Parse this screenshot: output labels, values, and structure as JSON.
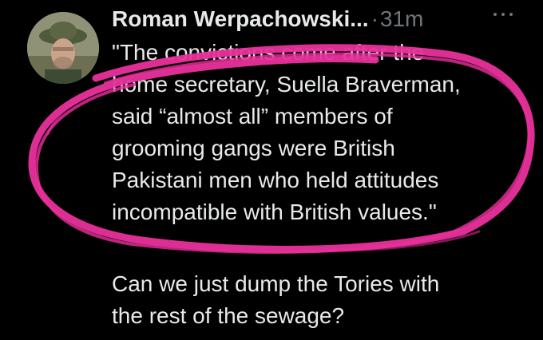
{
  "tweet": {
    "author_name": "Roman Werpachowski...",
    "separator": "·",
    "timestamp": "31m",
    "quote_lines": [
      "\"The convictions come after the",
      "home secretary, Suella Braverman,",
      "said “almost all” members of",
      "grooming gangs were British",
      "Pakistani men who held attitudes",
      "incompatible with British values.\""
    ],
    "comment_lines": [
      "Can we just dump the Tories with",
      "the rest of the sewage?"
    ]
  },
  "colors": {
    "background": "#000000",
    "text": "#e7e9ea",
    "secondary_text": "#71767b",
    "annotation": "#e8309b"
  },
  "icons": {
    "more": "three-dots-icon",
    "annotation": "hand-drawn-circle"
  }
}
